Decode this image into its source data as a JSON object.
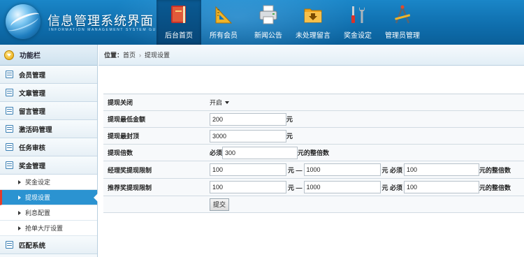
{
  "app": {
    "title": "信息管理系统界面",
    "subtitle": "INFORMATION MANAGEMENT SYSTEM GUI"
  },
  "nav": [
    {
      "label": "后台首页",
      "icon": "book-icon",
      "active": true
    },
    {
      "label": "所有会员",
      "icon": "ruler-triangle-icon",
      "active": false
    },
    {
      "label": "新闻公告",
      "icon": "printer-icon",
      "active": false
    },
    {
      "label": "未处理留言",
      "icon": "folder-download-icon",
      "active": false
    },
    {
      "label": "奖金设定",
      "icon": "tools-icon",
      "active": false
    },
    {
      "label": "管理员管理",
      "icon": "compass-tools-icon",
      "active": false
    }
  ],
  "sidebar": {
    "header": "功能栏",
    "sections": [
      {
        "label": "会员管理"
      },
      {
        "label": "文章管理"
      },
      {
        "label": "留言管理"
      },
      {
        "label": "激活码管理"
      },
      {
        "label": "任务审核"
      },
      {
        "label": "奖金管理"
      }
    ],
    "subitems": [
      {
        "label": "奖金设定",
        "active": false
      },
      {
        "label": "提现设置",
        "active": true
      },
      {
        "label": "利息配置",
        "active": false
      },
      {
        "label": "抢单大厅设置",
        "active": false
      }
    ],
    "last_section": {
      "label": "匹配系统"
    }
  },
  "breadcrumb": {
    "location_label": "位置：",
    "home": "首页",
    "separator": "›",
    "current": "提现设置"
  },
  "form": {
    "rows": [
      {
        "label": "提现关闭",
        "select_value": "开启"
      },
      {
        "label": "提现最低金额",
        "value": "200",
        "unit": "元"
      },
      {
        "label": "提现最封顶",
        "value": "3000",
        "unit": "元"
      },
      {
        "label": "提现倍数",
        "prefix": "必须",
        "value": "300",
        "unit": "元的整倍数"
      },
      {
        "label": "经理奖提现限制",
        "min": "100",
        "dash": "元 —",
        "max": "1000",
        "mid": "元 必须",
        "multiple": "100",
        "unit": "元的整倍数"
      },
      {
        "label": "推荐奖提现限制",
        "min": "100",
        "dash": "元 —",
        "max": "1000",
        "mid": "元 必须",
        "multiple": "100",
        "unit": "元的整倍数"
      }
    ],
    "submit_label": "提交"
  }
}
